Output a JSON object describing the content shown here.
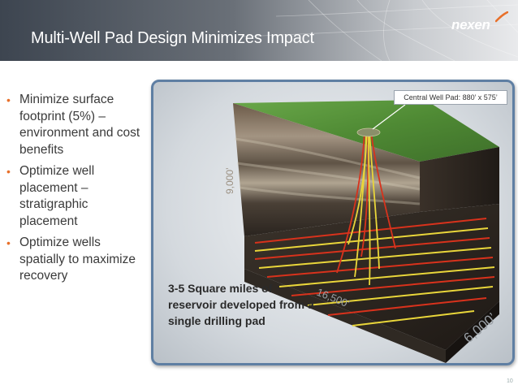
{
  "slide": {
    "title": "Multi-Well Pad Design Minimizes Impact",
    "logo": "nexen",
    "page_number": "10"
  },
  "bullets": [
    {
      "text": "Minimize surface footprint (5%) – environment and cost benefits"
    },
    {
      "text": "Optimize well placement – stratigraphic placement"
    },
    {
      "text": "Optimize wells spatially to maximize recovery"
    }
  ],
  "figure": {
    "callout": "Central Well Pad: 880’ x 575’",
    "caption": "3-5 Square miles of reservoir developed from a single drilling pad",
    "depth_label": "9,000’",
    "length_label": "16,500’",
    "width_label": "6,000’"
  },
  "colors": {
    "accent": "#e8702a",
    "frame_border": "#5f7fa3",
    "well_red": "#d8321c",
    "well_yellow": "#e9d63a",
    "grass": "#4f8a34"
  }
}
